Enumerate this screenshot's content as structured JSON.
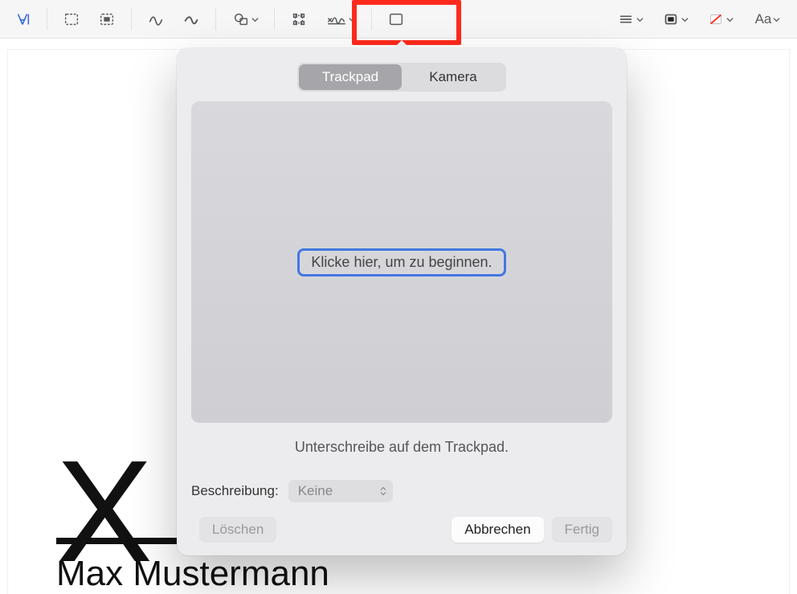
{
  "toolbar": {
    "text_tool": "A|",
    "font_label": "Aa"
  },
  "popover": {
    "tabs": {
      "trackpad": "Trackpad",
      "camera": "Kamera"
    },
    "start_hint": "Klicke hier, um zu beginnen.",
    "instruction": "Unterschreibe auf dem Trackpad.",
    "description_label": "Beschreibung:",
    "description_value": "Keine",
    "buttons": {
      "delete": "Löschen",
      "cancel": "Abbrechen",
      "done": "Fertig"
    }
  },
  "document": {
    "mark": "X",
    "name": "Max Mustermann"
  }
}
